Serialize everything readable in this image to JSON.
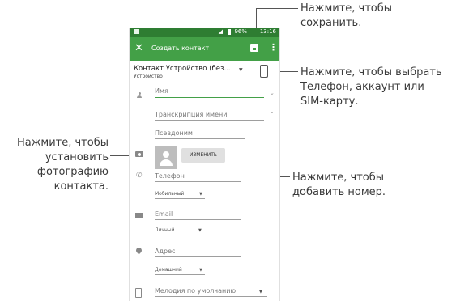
{
  "callouts": {
    "save": "Нажмите, чтобы\nсохранить.",
    "account": "Нажмите, чтобы выбрать\nТелефон, аккаунт или\nSIM-карту.",
    "photo": "Нажмите, чтобы\nустановить\nфотографию\nконтакта.",
    "number": "Нажмите, чтобы\nдобавить номер."
  },
  "status": {
    "battery": "96%",
    "time": "13:16"
  },
  "appbar": {
    "close": "✕",
    "title": "Создать контакт",
    "more": "⋮"
  },
  "account": {
    "name": "Контакт Устройство (без...",
    "sub": "Устройство"
  },
  "fields": {
    "name": "Имя",
    "transcription": "Транскрипция имени",
    "nickname": "Псевдоним",
    "change_photo": "ИЗМЕНИТЬ",
    "phone": "Телефон",
    "phone_type": "Мобильный",
    "email": "Email",
    "email_type": "Личный",
    "address": "Адрес",
    "address_type": "Домашний",
    "ringtone": "Мелодия по умолчанию"
  },
  "icons": [
    "close-icon",
    "save-icon",
    "more-icon",
    "phone-device-icon",
    "person-icon",
    "camera-icon",
    "phone-icon",
    "email-icon",
    "location-icon",
    "ringtone-icon",
    "chevron-down-icon"
  ],
  "colors": {
    "appbar": "#43a047",
    "statusbar": "#2e7d32",
    "accent": "#43a047"
  }
}
